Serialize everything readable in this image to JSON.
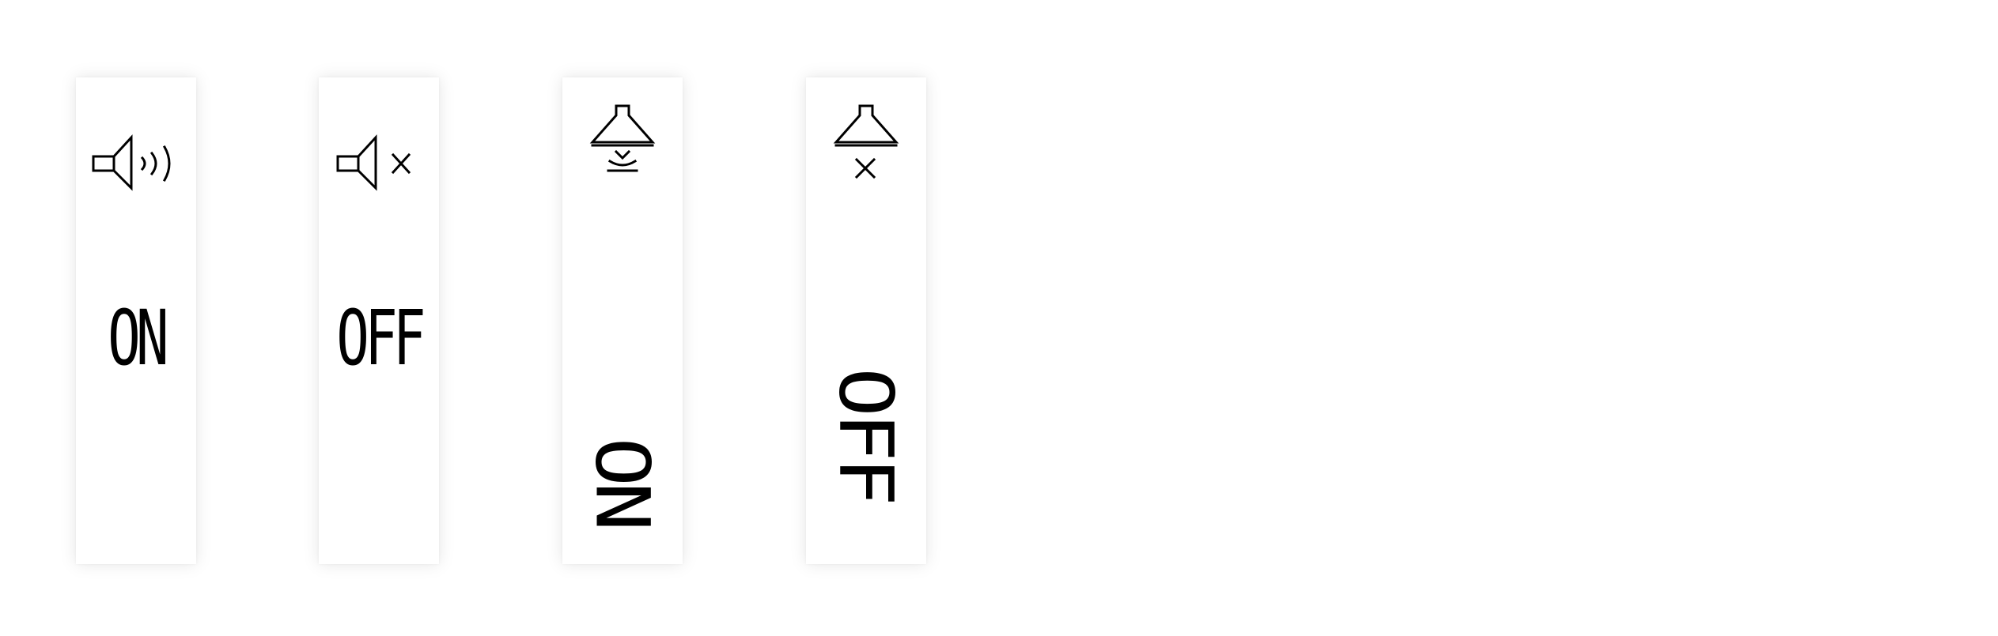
{
  "panels": [
    {
      "id": "speaker-on",
      "icon": "speaker-sound-icon",
      "label": "ON"
    },
    {
      "id": "speaker-off",
      "icon": "speaker-mute-icon",
      "label": "OFF"
    },
    {
      "id": "light-on",
      "icon": "lamp-on-icon",
      "label": "ON"
    },
    {
      "id": "light-off",
      "icon": "lamp-off-icon",
      "label": "OFF"
    }
  ],
  "colors": {
    "background": "#ffffff",
    "panel": "#ffffff",
    "ink": "#000000"
  }
}
